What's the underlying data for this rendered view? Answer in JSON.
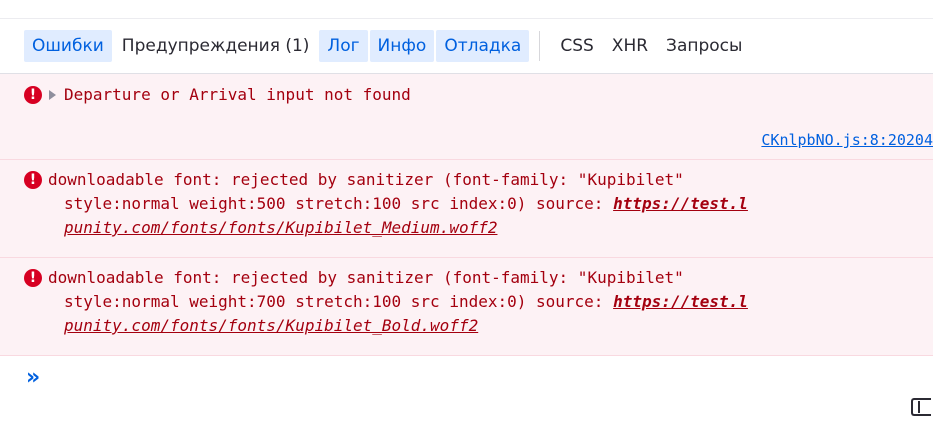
{
  "filters": {
    "tabs": [
      {
        "label": "Ошибки",
        "active": true
      },
      {
        "label": "Предупреждения (1)",
        "active": false
      },
      {
        "label": "Лог",
        "active": true
      },
      {
        "label": "Инфо",
        "active": true
      },
      {
        "label": "Отладка",
        "active": true
      }
    ],
    "extra": [
      {
        "label": "CSS"
      },
      {
        "label": "XHR"
      },
      {
        "label": "Запросы"
      }
    ]
  },
  "messages": [
    {
      "icon": "error-icon",
      "lines": [
        "Departure or Arrival input not found"
      ],
      "source": "CKnlpbNO.js:8:20204"
    },
    {
      "icon": "error-icon",
      "line1": "downloadable font: rejected by sanitizer (font-family: \"Kupibilet\"",
      "line2_text": "style:normal weight:500 stretch:100 src index:0) source: ",
      "line2_link": "https://test.l",
      "line3_link": "punity.com/fonts/fonts/Kupibilet_Medium.woff2"
    },
    {
      "icon": "error-icon",
      "line1": "downloadable font: rejected by sanitizer (font-family: \"Kupibilet\"",
      "line2_text": "style:normal weight:700 stretch:100 src index:0) source: ",
      "line2_link": "https://test.l",
      "line3_link": "punity.com/fonts/fonts/Kupibilet_Bold.woff2"
    }
  ],
  "prompt": {
    "symbol": "»"
  },
  "colors": {
    "error_bg": "#fdf2f5",
    "error_text": "#a4000f",
    "accent": "#0060df"
  }
}
